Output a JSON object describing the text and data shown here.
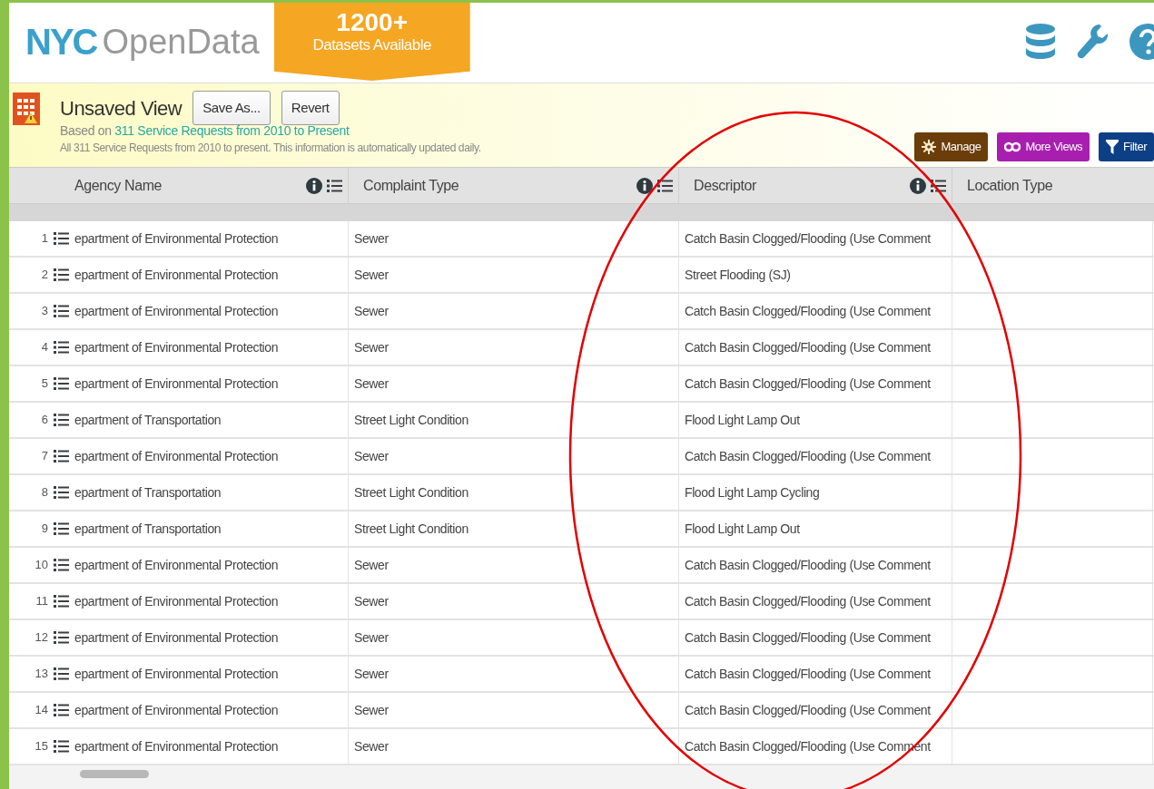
{
  "header": {
    "logo": {
      "mark": "NYC",
      "name": "OpenData"
    },
    "banner": {
      "count": "1200+",
      "caption": "Datasets Available"
    }
  },
  "view": {
    "title": "Unsaved View",
    "buttons": [
      "Save As...",
      "Revert"
    ],
    "based_on_prefix": "Based on",
    "based_on_link": "311 Service Requests from 2010 to Present",
    "description": "All 311 Service Requests from 2010 to present. This information is automatically updated daily.",
    "actions": [
      {
        "label": "Manage",
        "kind": "manage",
        "color": "#6b3d0a"
      },
      {
        "label": "More Views",
        "kind": "views",
        "color": "#a81fb0"
      },
      {
        "label": "Filter",
        "kind": "filter",
        "color": "#0d3f86"
      }
    ]
  },
  "table": {
    "columns": [
      {
        "label": "Agency Name",
        "menu": true
      },
      {
        "label": "Complaint Type",
        "menu": true
      },
      {
        "label": "Descriptor",
        "menu": true
      },
      {
        "label": "Location Type",
        "menu": false
      }
    ],
    "rows": [
      {
        "number": "1",
        "cells": [
          "epartment of Environmental Protection",
          "Sewer",
          "Catch Basin Clogged/Flooding (Use Comment"
        ]
      },
      {
        "number": "2",
        "cells": [
          "epartment of Environmental Protection",
          "Sewer",
          "Street Flooding (SJ)"
        ]
      },
      {
        "number": "3",
        "cells": [
          "epartment of Environmental Protection",
          "Sewer",
          "Catch Basin Clogged/Flooding (Use Comment"
        ]
      },
      {
        "number": "4",
        "cells": [
          "epartment of Environmental Protection",
          "Sewer",
          "Catch Basin Clogged/Flooding (Use Comment"
        ]
      },
      {
        "number": "5",
        "cells": [
          "epartment of Environmental Protection",
          "Sewer",
          "Catch Basin Clogged/Flooding (Use Comment"
        ]
      },
      {
        "number": "6",
        "cells": [
          "epartment of Transportation",
          "Street Light Condition",
          "Flood Light Lamp Out"
        ]
      },
      {
        "number": "7",
        "cells": [
          "epartment of Environmental Protection",
          "Sewer",
          "Catch Basin Clogged/Flooding (Use Comment"
        ]
      },
      {
        "number": "8",
        "cells": [
          "epartment of Transportation",
          "Street Light Condition",
          "Flood Light Lamp Cycling"
        ]
      },
      {
        "number": "9",
        "cells": [
          "epartment of Transportation",
          "Street Light Condition",
          "Flood Light Lamp Out"
        ]
      },
      {
        "number": "10",
        "cells": [
          "epartment of Environmental Protection",
          "Sewer",
          "Catch Basin Clogged/Flooding (Use Comment"
        ]
      },
      {
        "number": "11",
        "cells": [
          "epartment of Environmental Protection",
          "Sewer",
          "Catch Basin Clogged/Flooding (Use Comment"
        ]
      },
      {
        "number": "12",
        "cells": [
          "epartment of Environmental Protection",
          "Sewer",
          "Catch Basin Clogged/Flooding (Use Comment"
        ]
      },
      {
        "number": "13",
        "cells": [
          "epartment of Environmental Protection",
          "Sewer",
          "Catch Basin Clogged/Flooding (Use Comment"
        ]
      },
      {
        "number": "14",
        "cells": [
          "epartment of Environmental Protection",
          "Sewer",
          "Catch Basin Clogged/Flooding (Use Comment"
        ]
      },
      {
        "number": "15",
        "cells": [
          "epartment of Environmental Protection",
          "Sewer",
          "Catch Basin Clogged/Flooding (Use Comment"
        ]
      }
    ]
  }
}
